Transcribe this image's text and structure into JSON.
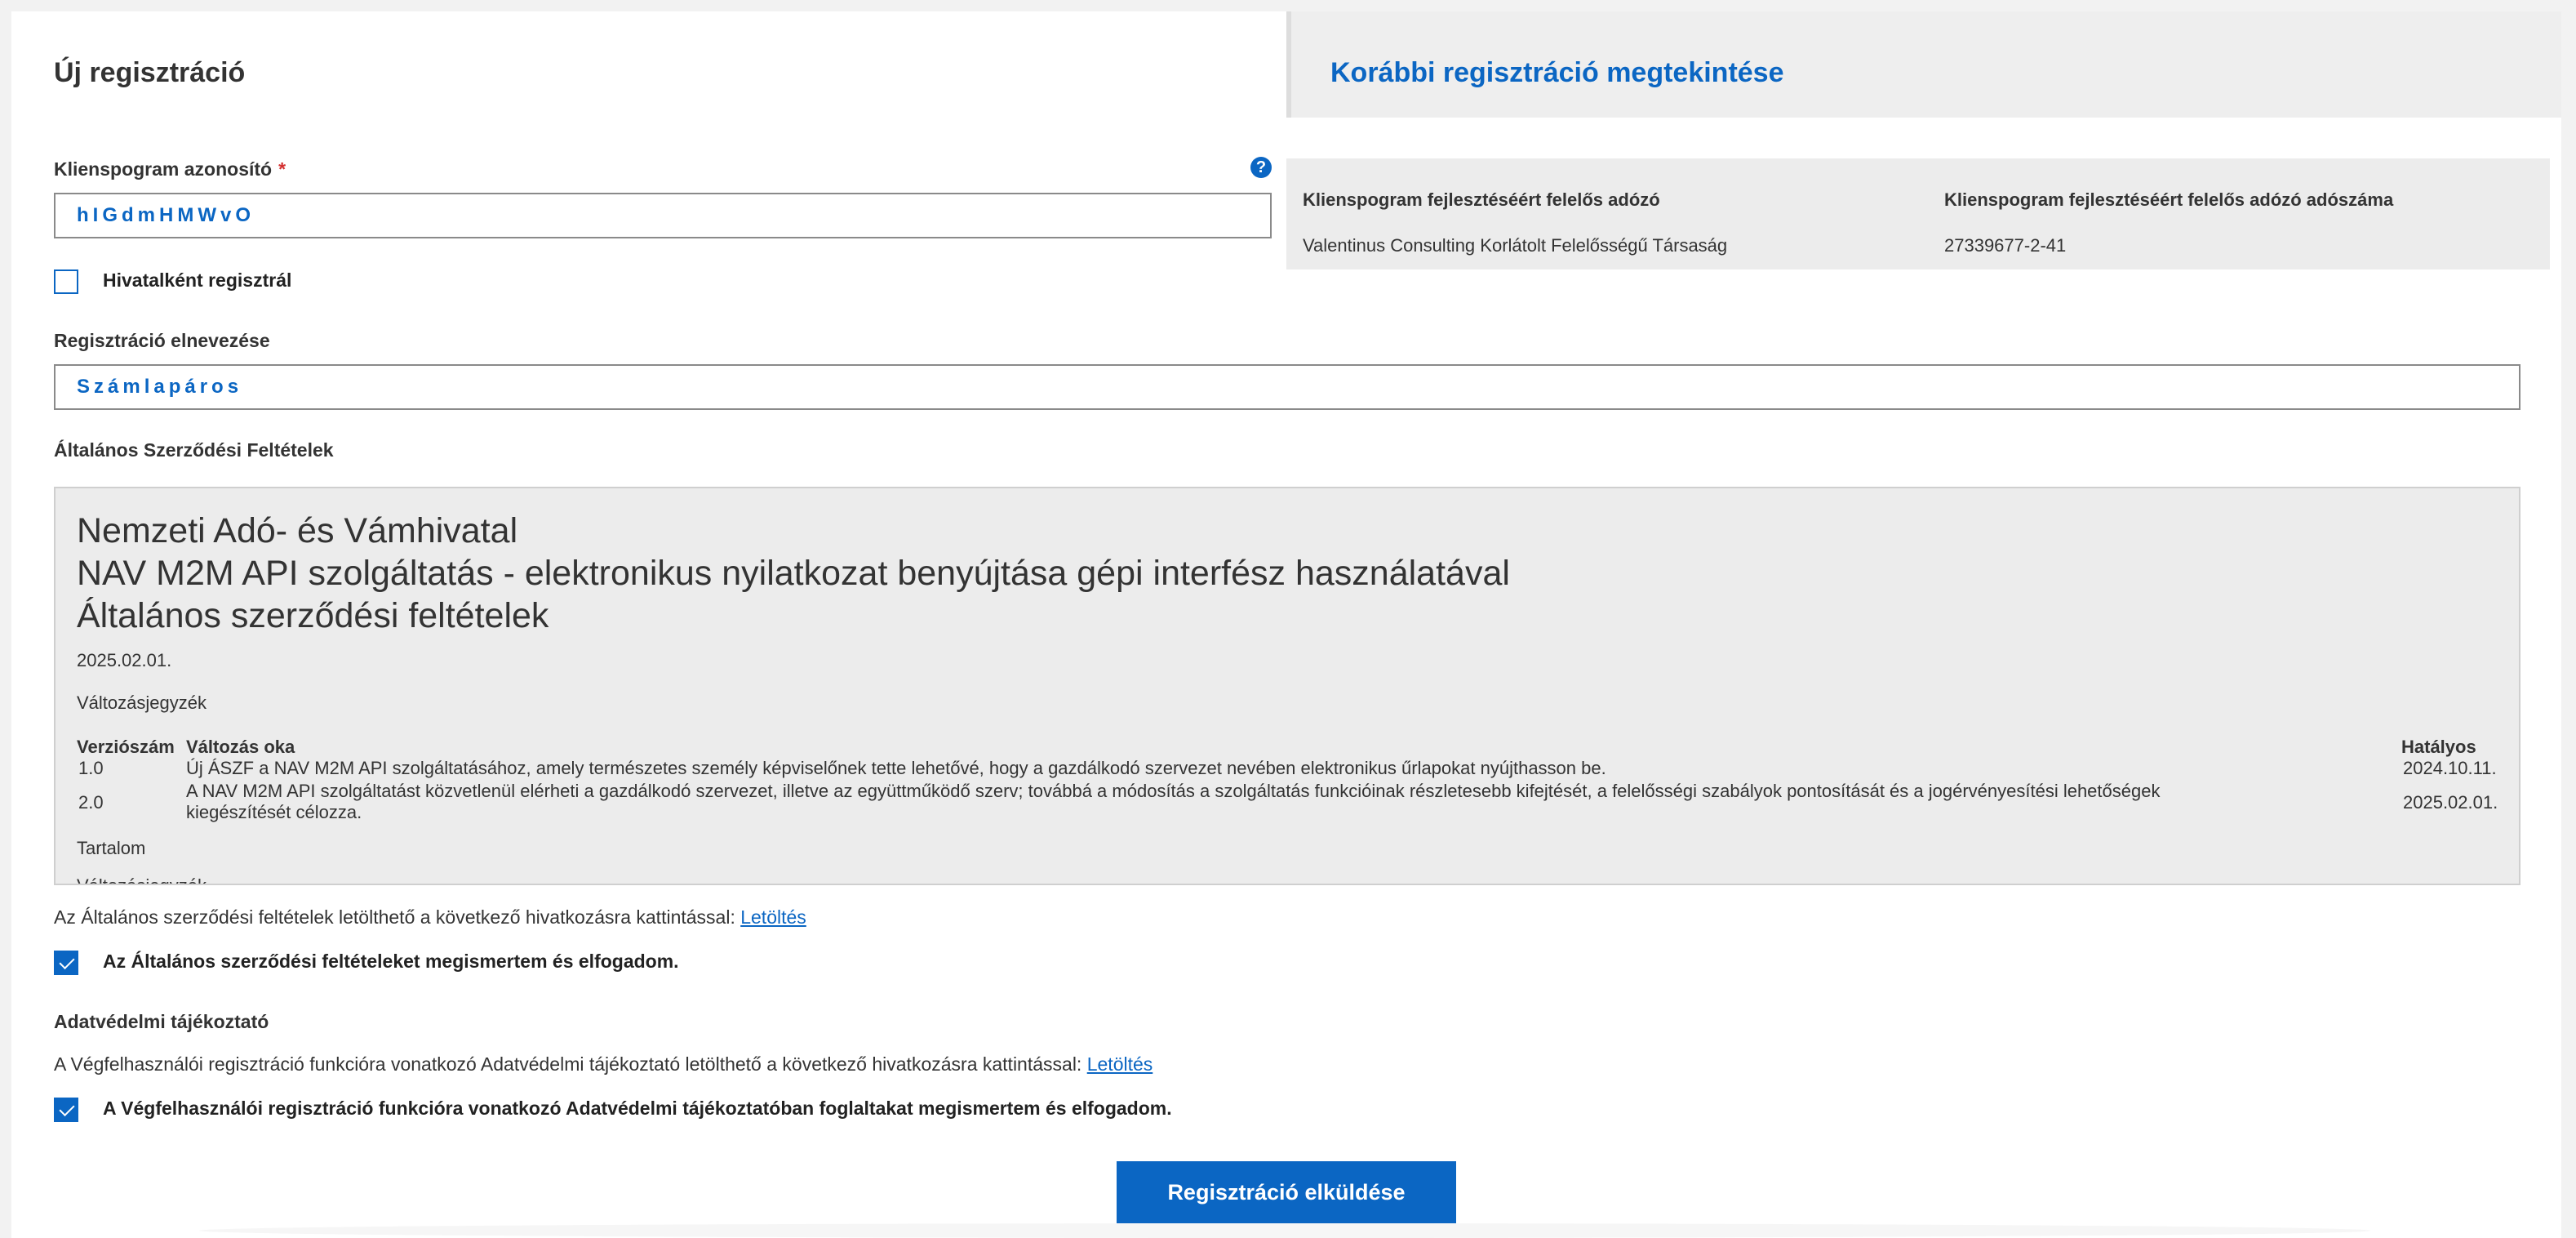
{
  "tabs": {
    "new_registration": "Új regisztráció",
    "previous_registration": "Korábbi regisztráció megtekintése"
  },
  "client_program": {
    "label": "Klienspogram azonosító",
    "required_mark": "*",
    "value": "hIGdmHMWvO"
  },
  "help_icon": {
    "glyph": "?",
    "icon": "help-icon"
  },
  "official_checkbox": {
    "label": "Hivatalként regisztrál",
    "checked": false
  },
  "developer": {
    "taxpayer_header": "Klienspogram fejlesztéséért felelős adózó",
    "taxpayer_value": "Valentinus Consulting Korlátolt Felelősségű Társaság",
    "tax_number_header": "Klienspogram fejlesztéséért felelős adózó adószáma",
    "tax_number_value": "27339677-2-41"
  },
  "registration_name": {
    "label": "Regisztráció elnevezése",
    "value": "Számlapáros"
  },
  "terms_section": {
    "label": "Általános Szerződési Feltételek",
    "title_line1": "Nemzeti Adó- és Vámhivatal",
    "title_line2": "NAV M2M API szolgáltatás - elektronikus nyilatkozat benyújtása gépi interfész használatával",
    "title_line3": "Általános szerződési feltételek",
    "date": "2025.02.01.",
    "changelog_heading": "Változásjegyzék",
    "table": {
      "headers": [
        "Verziószám",
        "Változás oka",
        "Hatályos"
      ],
      "rows": [
        {
          "version": "1.0",
          "reason": "Új ÁSZF a NAV M2M API szolgáltatásához, amely természetes személy képviselőnek tette lehetővé, hogy a gazdálkodó szervezet nevében elektronikus űrlapokat nyújthasson be.",
          "effective": "2024.10.11."
        },
        {
          "version": "2.0",
          "reason_line1": "A NAV M2M API szolgáltatást közvetlenül elérheti a gazdálkodó szervezet, illetve az együttműködő szerv; továbbá a módosítás a szolgáltatás funkcióinak részletesebb kifejtését, a felelősségi szabályok pontosítását és a jogérvényesítési lehetőségek",
          "reason_line2": "kiegészítését célozza.",
          "effective": "2025.02.01."
        }
      ]
    },
    "contents_heading": "Tartalom",
    "changelog_repeat": "Változásjegyzék"
  },
  "terms_download": {
    "text": "Az Általános szerződési feltételek letölthető a következő hivatkozásra kattintással: ",
    "link": "Letöltés"
  },
  "terms_accept": {
    "label": "Az Általános szerződési feltételeket megismertem és elfogadom.",
    "checked": true
  },
  "privacy": {
    "label": "Adatvédelmi tájékoztató",
    "text": "A Végfelhasználói regisztráció funkcióra vonatkozó Adatvédelmi tájékoztató letölthető a következő hivatkozásra kattintással: ",
    "link": "Letöltés"
  },
  "privacy_accept": {
    "label": "A Végfelhasználói regisztráció funkcióra vonatkozó Adatvédelmi tájékoztatóban foglaltakat megismertem és elfogadom.",
    "checked": true
  },
  "submit_button": "Regisztráció elküldése",
  "colors": {
    "accent": "#0b66c3",
    "required": "#d32f2f",
    "panel": "#ececec"
  }
}
